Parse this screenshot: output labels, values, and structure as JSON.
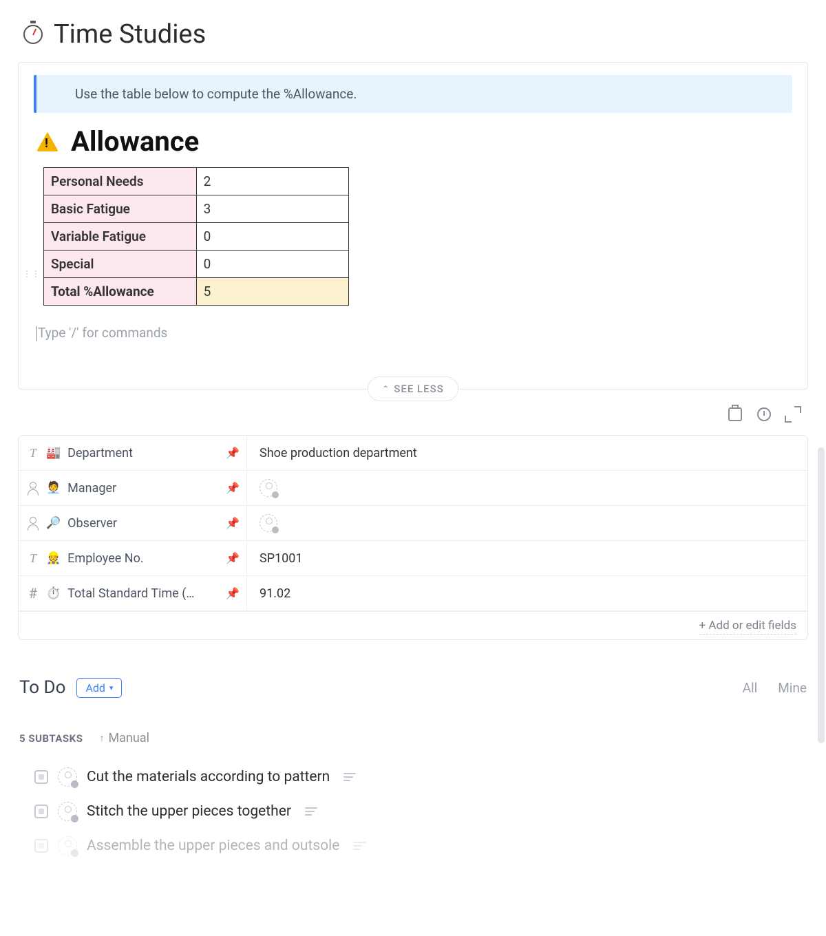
{
  "header": {
    "title": "Time Studies"
  },
  "banner": {
    "text": "Use the table below to compute the %Allowance."
  },
  "allowance": {
    "heading": "Allowance",
    "rows": [
      {
        "label": "Personal Needs",
        "value": "2"
      },
      {
        "label": "Basic Fatigue",
        "value": "3"
      },
      {
        "label": "Variable Fatigue",
        "value": "0"
      },
      {
        "label": "Special",
        "value": "0"
      }
    ],
    "total": {
      "label": "Total %Allowance",
      "value": "5"
    }
  },
  "command_placeholder": "Type '/' for commands",
  "see_less": "SEE LESS",
  "fields": {
    "department": {
      "label": "Department",
      "value": "Shoe production department"
    },
    "manager": {
      "label": "Manager",
      "value": ""
    },
    "observer": {
      "label": "Observer",
      "value": ""
    },
    "employee_no": {
      "label": "Employee No.",
      "value": "SP1001"
    },
    "total_std_time": {
      "label": "Total Standard Time (mi…",
      "value": "91.02"
    },
    "add_edit": "+ Add or edit fields"
  },
  "todo": {
    "heading": "To Do",
    "add_label": "Add",
    "filter_all": "All",
    "filter_mine": "Mine",
    "count_label": "5 SUBTASKS",
    "sort_label": "Manual",
    "tasks": [
      {
        "title": "Cut the materials according to pattern"
      },
      {
        "title": "Stitch the upper pieces together"
      },
      {
        "title": "Assemble the upper pieces and outsole"
      }
    ]
  }
}
